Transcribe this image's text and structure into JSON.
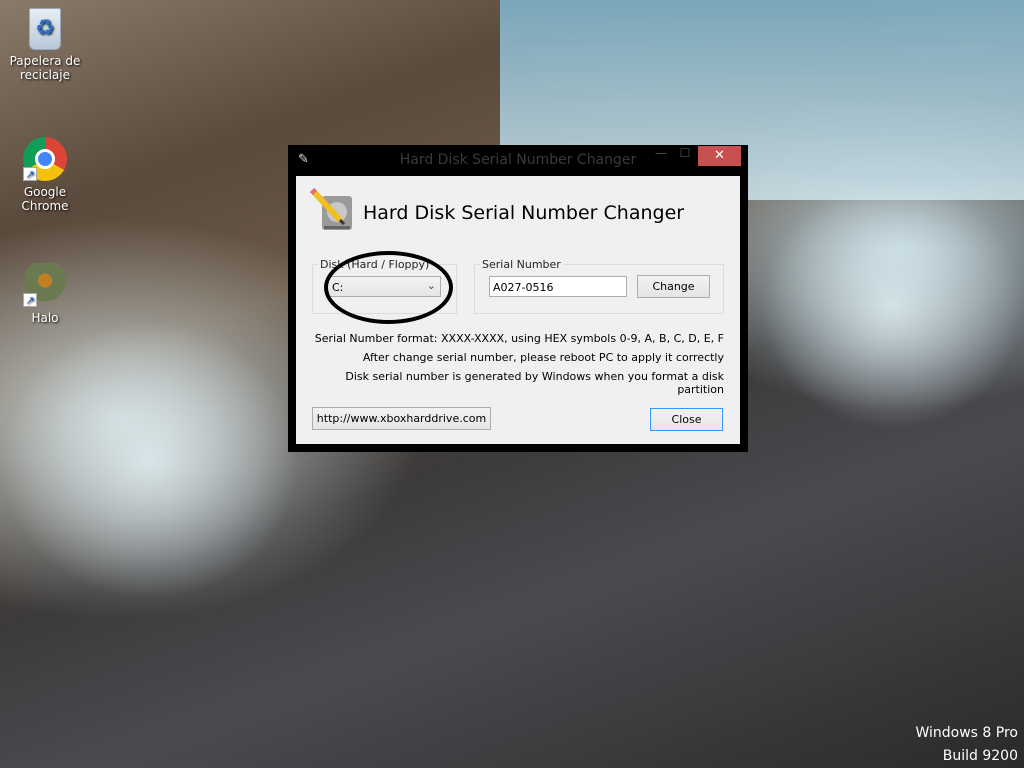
{
  "desktop": {
    "icons": [
      {
        "label": "Papelera de reciclaje",
        "icon": "recycle-bin-icon"
      },
      {
        "label": "Google Chrome",
        "icon": "chrome-icon"
      },
      {
        "label": "Halo",
        "icon": "halo-icon"
      }
    ],
    "watermark": {
      "line1": "Windows 8 Pro",
      "line2": "Build 9200"
    }
  },
  "window": {
    "title": "Hard Disk Serial Number Changer",
    "header_title": "Hard Disk Serial Number Changer",
    "disk_group_label": "Disk (Hard / Floppy)",
    "disk_selected": "C:",
    "serial_group_label": "Serial Number",
    "serial_value": "A027-0516",
    "change_label": "Change",
    "notes": [
      "Serial Number format: XXXX-XXXX, using HEX symbols 0-9, A, B, C, D, E, F",
      "After change serial number, please reboot PC to apply it correctly",
      "Disk serial number is generated by Windows when you format a disk partition"
    ],
    "link_label": "http://www.xboxharddrive.com",
    "close_label": "Close",
    "close_accent": "#c75050",
    "focus_accent": "#3399ff"
  }
}
